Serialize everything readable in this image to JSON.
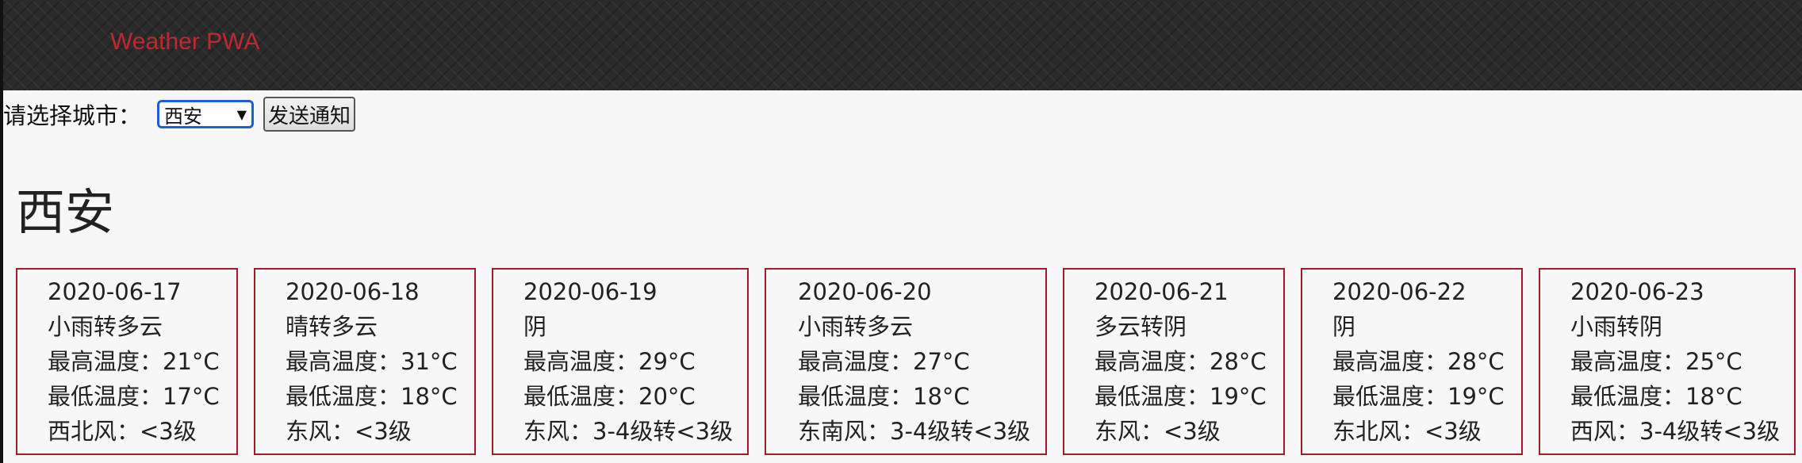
{
  "app": {
    "title": "Weather PWA"
  },
  "controls": {
    "city_label": "请选择城市：",
    "selected_city": "西安",
    "notify_button": "发送通知"
  },
  "city": {
    "name": "西安"
  },
  "forecast": [
    {
      "date": "2020-06-17",
      "weather": "小雨转多云",
      "high": "最高温度：21°C",
      "low": "最低温度：17°C",
      "wind": "西北风：<3级"
    },
    {
      "date": "2020-06-18",
      "weather": "晴转多云",
      "high": "最高温度：31°C",
      "low": "最低温度：18°C",
      "wind": "东风：<3级"
    },
    {
      "date": "2020-06-19",
      "weather": "阴",
      "high": "最高温度：29°C",
      "low": "最低温度：20°C",
      "wind": "东风：3-4级转<3级"
    },
    {
      "date": "2020-06-20",
      "weather": "小雨转多云",
      "high": "最高温度：27°C",
      "low": "最低温度：18°C",
      "wind": "东南风：3-4级转<3级"
    },
    {
      "date": "2020-06-21",
      "weather": "多云转阴",
      "high": "最高温度：28°C",
      "low": "最低温度：19°C",
      "wind": "东风：<3级"
    },
    {
      "date": "2020-06-22",
      "weather": "阴",
      "high": "最高温度：28°C",
      "low": "最低温度：19°C",
      "wind": "东北风：<3级"
    },
    {
      "date": "2020-06-23",
      "weather": "小雨转阴",
      "high": "最高温度：25°C",
      "low": "最低温度：18°C",
      "wind": "西风：3-4级转<3级"
    }
  ],
  "colors": {
    "accent": "#c0282f",
    "card_border": "#a31a2a",
    "header_bg": "#2a2a2a"
  }
}
